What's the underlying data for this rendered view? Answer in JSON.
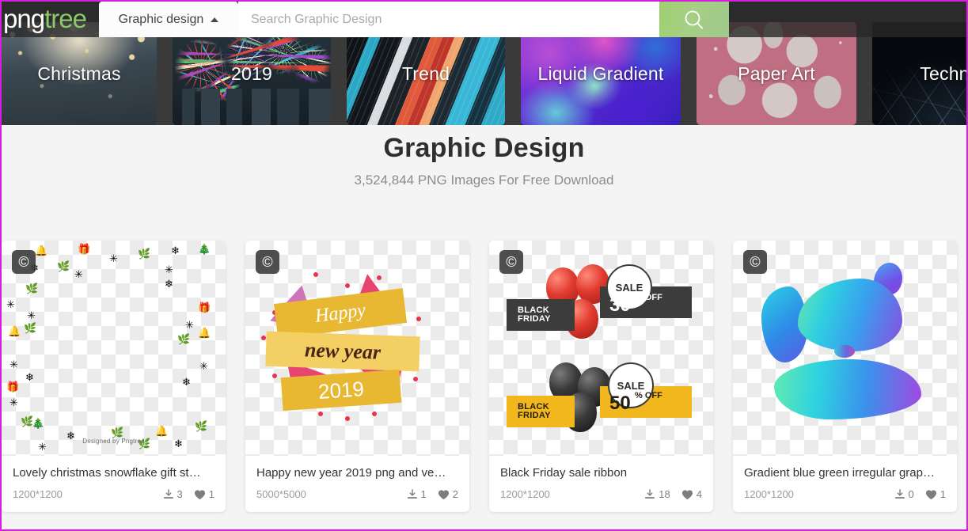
{
  "header": {
    "logo_png": "png",
    "logo_tree": "tree",
    "category_selected": "Graphic design",
    "search_placeholder": "Search Graphic Design",
    "search_value": "",
    "search_icon": "search-icon",
    "caret_icon": "caret-up-icon",
    "accent_green": "#9ed06f",
    "overlay_color": "#282828"
  },
  "banners": [
    {
      "label": "Christmas",
      "art": "christmas"
    },
    {
      "label": "2019",
      "art": "fireworks"
    },
    {
      "label": "Trend",
      "art": "trend"
    },
    {
      "label": "Liquid Gradient",
      "art": "liquid-gradient"
    },
    {
      "label": "Paper Art",
      "art": "paper-art"
    },
    {
      "label": "Technic",
      "art": "technic"
    }
  ],
  "page": {
    "title": "Graphic Design",
    "subtitle": "3,524,844 PNG Images For Free Download"
  },
  "cards": [
    {
      "title": "Lovely christmas snowflake gift st…",
      "dimensions": "1200*1200",
      "downloads": "3",
      "likes": "1",
      "badge": "©",
      "credit": "Designed by Pngtree"
    },
    {
      "title": "Happy new year 2019 png and ve…",
      "dimensions": "5000*5000",
      "downloads": "1",
      "likes": "2",
      "badge": "©",
      "art_text": {
        "line1": "Happy",
        "line2": "new year",
        "line3": "2019"
      }
    },
    {
      "title": "Black Friday sale ribbon",
      "dimensions": "1200*1200",
      "downloads": "18",
      "likes": "4",
      "badge": "©",
      "art_text": {
        "top_label": "BLACK FRIDAY",
        "top_sale": "SALE",
        "top_pct": "30",
        "top_off": "% OFF",
        "bottom_label": "BLACK FRIDAY",
        "bottom_sale": "SALE",
        "bottom_pct": "50",
        "bottom_off": "% OFF"
      }
    },
    {
      "title": "Gradient blue green irregular grap…",
      "dimensions": "1200*1200",
      "downloads": "0",
      "likes": "1",
      "badge": "©"
    }
  ],
  "icons": {
    "download": "download-icon",
    "like": "heart-icon",
    "copyright": "copyright-icon"
  },
  "theme": {
    "page_bg": "#f4f4f4",
    "card_bg": "#ffffff",
    "border": "#d51ee0",
    "title_color": "#2f2f2f"
  }
}
